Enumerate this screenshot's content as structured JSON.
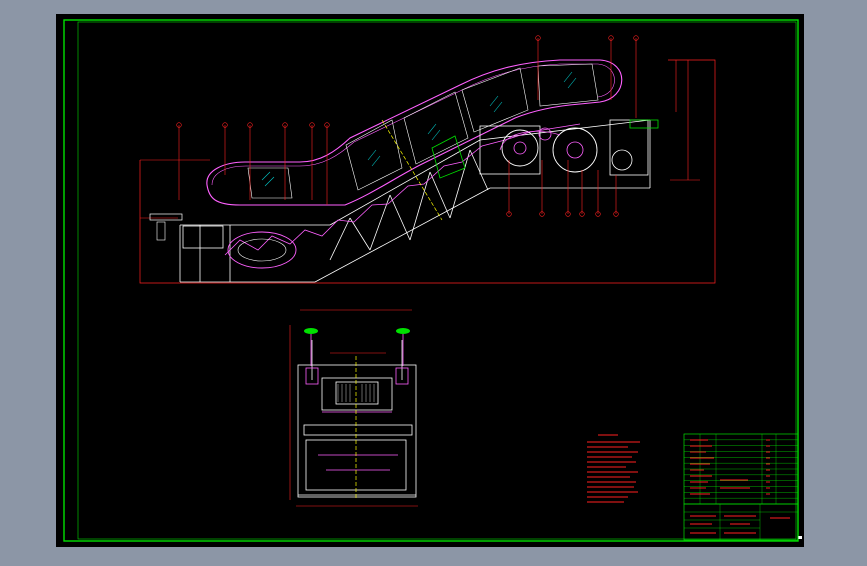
{
  "colors": {
    "window_bg": "#8c96a6",
    "drawing_bg": "#000000",
    "frame": "#00e000",
    "outline": "#ffffff",
    "dimension": "#ff2020",
    "handrail": "#ff60ff",
    "centerline": "#ffff00",
    "glass": "#00c8c8"
  },
  "drawing": {
    "side_view_balloons": [
      "",
      "",
      "",
      "",
      "",
      "",
      "",
      "",
      "",
      "",
      "",
      "",
      "",
      "",
      "",
      ""
    ],
    "notes_text": [],
    "parts_table": {
      "rows": 12,
      "cols": 5
    },
    "title_block": {
      "drawing_number": "",
      "title": ""
    }
  }
}
